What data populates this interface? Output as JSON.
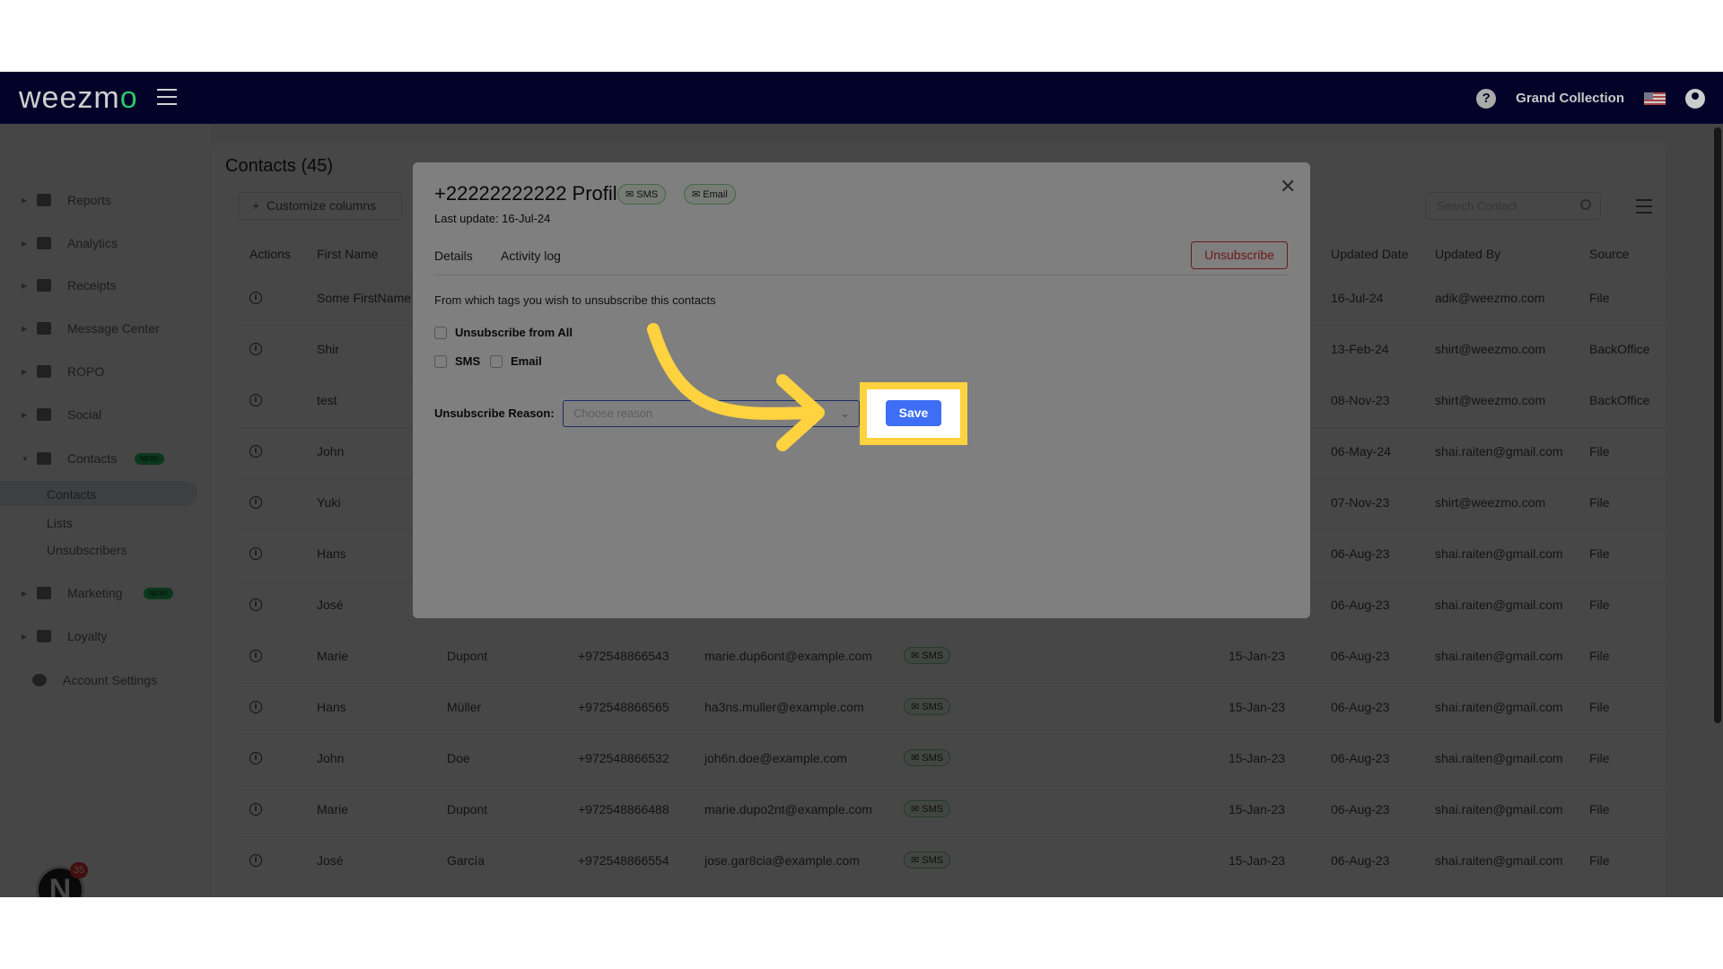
{
  "header": {
    "logo": "weezmo",
    "store": "Grand Collection",
    "help_icon": "question-circle-icon",
    "flag_icon": "us-flag-icon",
    "user_icon": "user-circle-icon"
  },
  "sidebar": {
    "items": [
      {
        "label": "Reports",
        "icon": "dashboard-icon"
      },
      {
        "label": "Analytics",
        "icon": "chart-icon"
      },
      {
        "label": "Receipts",
        "icon": "receipt-icon"
      },
      {
        "label": "Message Center",
        "icon": "chat-icon"
      },
      {
        "label": "ROPO",
        "icon": "infinity-icon"
      },
      {
        "label": "Social",
        "icon": "people-icon"
      },
      {
        "label": "Contacts",
        "icon": "contacts-icon",
        "badge": "NEW!"
      },
      {
        "label": "Marketing",
        "icon": "party-icon",
        "badge": "NEW!"
      },
      {
        "label": "Loyalty",
        "icon": "tag-icon"
      },
      {
        "label": "Account Settings",
        "icon": "gear-icon"
      }
    ],
    "sub": [
      "Contacts",
      "Lists",
      "Unsubscribers"
    ],
    "notif_count": "35",
    "avatar_letter": "N"
  },
  "main": {
    "title": "Contacts (45)",
    "customize": "Customize columns",
    "search_placeholder": "Search Contact",
    "columns": {
      "actions": "Actions",
      "first": "First Name",
      "updated": "Updated Date",
      "by": "Updated By",
      "source": "Source"
    },
    "rows": [
      {
        "first": "Some FirstName",
        "updated": "16-Jul-24",
        "by": "adik@weezmo.com",
        "source": "File"
      },
      {
        "first": "Shir",
        "updated": "13-Feb-24",
        "by": "shirt@weezmo.com",
        "source": "BackOffice"
      },
      {
        "first": "test",
        "updated": "08-Nov-23",
        "by": "shirt@weezmo.com",
        "source": "BackOffice"
      },
      {
        "first": "John",
        "updated": "06-May-24",
        "by": "shai.raiten@gmail.com",
        "source": "File"
      },
      {
        "first": "Yuki",
        "updated": "07-Nov-23",
        "by": "shirt@weezmo.com",
        "source": "File"
      },
      {
        "first": "Hans",
        "updated": "06-Aug-23",
        "by": "shai.raiten@gmail.com",
        "source": "File"
      },
      {
        "first": "José",
        "updated": "06-Aug-23",
        "by": "shai.raiten@gmail.com",
        "source": "File"
      },
      {
        "first": "Marie",
        "last": "Dupont",
        "phone": "+972548866543",
        "email": "marie.dup6ont@example.com",
        "tag": "SMS",
        "created": "15-Jan-23",
        "updated": "06-Aug-23",
        "by": "shai.raiten@gmail.com",
        "source": "File"
      },
      {
        "first": "Hans",
        "last": "Müller",
        "phone": "+972548866565",
        "email": "ha3ns.muller@example.com",
        "tag": "SMS",
        "created": "15-Jan-23",
        "updated": "06-Aug-23",
        "by": "shai.raiten@gmail.com",
        "source": "File"
      },
      {
        "first": "John",
        "last": "Doe",
        "phone": "+972548866532",
        "email": "joh6n.doe@example.com",
        "tag": "SMS",
        "created": "15-Jan-23",
        "updated": "06-Aug-23",
        "by": "shai.raiten@gmail.com",
        "source": "File"
      },
      {
        "first": "Marie",
        "last": "Dupont",
        "phone": "+972548866488",
        "email": "marie.dupo2nt@example.com",
        "tag": "SMS",
        "created": "15-Jan-23",
        "updated": "06-Aug-23",
        "by": "shai.raiten@gmail.com",
        "source": "File"
      },
      {
        "first": "José",
        "last": "García",
        "phone": "+972548866554",
        "email": "jose.gar8cia@example.com",
        "tag": "SMS",
        "created": "15-Jan-23",
        "updated": "06-Aug-23",
        "by": "shai.raiten@gmail.com",
        "source": "File"
      }
    ]
  },
  "modal": {
    "title": "+22222222222 Profile:",
    "tags": [
      "SMS",
      "Email"
    ],
    "last_update": "Last update: 16-Jul-24",
    "tabs": [
      "Details",
      "Activity log"
    ],
    "unsubscribe": "Unsubscribe",
    "question": "From which tags you wish to unsubscribe this contacts",
    "options": {
      "all": "Unsubscribe from All",
      "sms": "SMS",
      "email": "Email"
    },
    "reason_label": "Unsubscribe Reason:",
    "reason_placeholder": "Choose reason",
    "save": "Save"
  },
  "colors": {
    "accent": "#3d6ef5",
    "highlight": "#ffd23f",
    "danger": "#d33333",
    "header": "#0a0a6e"
  }
}
